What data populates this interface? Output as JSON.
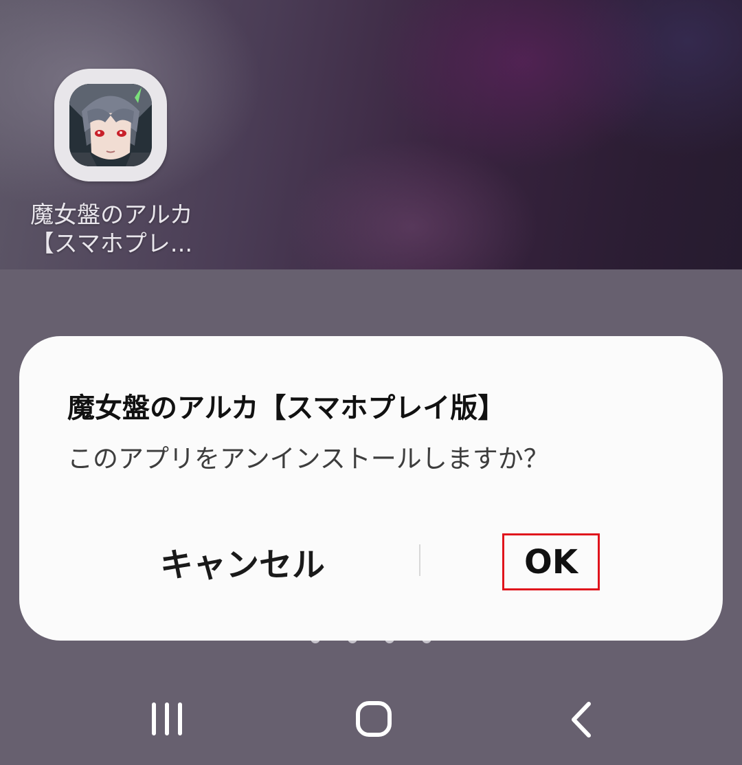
{
  "home_screen": {
    "app_shortcut": {
      "label_line1": "魔女盤のアルカ",
      "label_line2": "【スマホプレ..."
    },
    "page_indicator": {
      "count": 4
    }
  },
  "dialog": {
    "title": "魔女盤のアルカ【スマホプレイ版】",
    "message": "このアプリをアンインストールしますか？",
    "cancel_label": "キャンセル",
    "ok_label": "OK",
    "highlight_color": "#e0141c"
  },
  "nav_bar": {
    "recents_icon": "recents-icon",
    "home_icon": "home-icon",
    "back_icon": "back-icon"
  }
}
